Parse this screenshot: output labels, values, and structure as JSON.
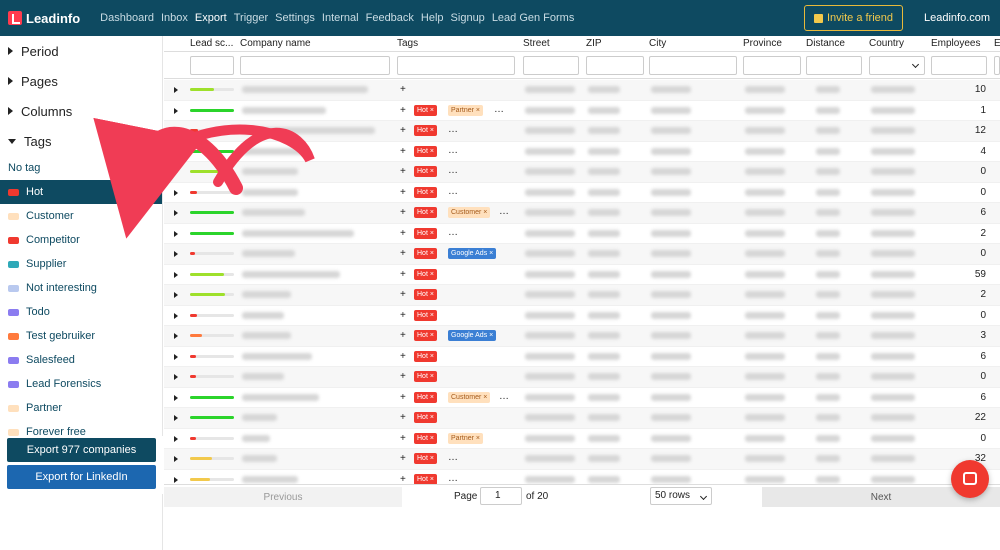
{
  "app": {
    "name": "Leadinfo",
    "domain_link": "Leadinfo.com",
    "invite_label": "Invite a friend"
  },
  "nav": {
    "items": [
      "Dashboard",
      "Inbox",
      "Export",
      "Trigger",
      "Settings",
      "Internal",
      "Feedback",
      "Help",
      "Signup",
      "Lead Gen Forms"
    ],
    "active": "Export"
  },
  "sidebar": {
    "sections": [
      "Period",
      "Pages",
      "Columns",
      "Tags"
    ],
    "no_tag": "No tag",
    "tags": [
      {
        "label": "Hot",
        "color": "#f0392f",
        "selected": true
      },
      {
        "label": "Customer",
        "color": "#ffe0bd"
      },
      {
        "label": "Competitor",
        "color": "#f0392f"
      },
      {
        "label": "Supplier",
        "color": "#2fa9b8"
      },
      {
        "label": "Not interesting",
        "color": "#b9c9ef"
      },
      {
        "label": "Todo",
        "color": "#8b7cf0"
      },
      {
        "label": "Test gebruiker",
        "color": "#ff7a3d"
      },
      {
        "label": "Salesfeed",
        "color": "#8b7cf0"
      },
      {
        "label": "Lead Forensics",
        "color": "#8b7cf0"
      },
      {
        "label": "Partner",
        "color": "#ffe0bd"
      },
      {
        "label": "Forever free",
        "color": "#ffe0bd"
      }
    ],
    "export_companies": "Export 977 companies",
    "export_linkedin": "Export for LinkedIn"
  },
  "table": {
    "headers": [
      "Lead sc...",
      "Company name",
      "Tags",
      "Street",
      "ZIP",
      "City",
      "Province",
      "Distance",
      "Country",
      "Employees",
      "E"
    ],
    "rows": [
      {
        "score": 0.55,
        "score_color": "#9ee02b",
        "tags": [],
        "employees": "10"
      },
      {
        "score": 1.0,
        "score_color": "#2bd42b",
        "tags": [
          "Hot",
          "Partner"
        ],
        "more": true,
        "employees": "1"
      },
      {
        "score": 0.18,
        "score_color": "#f0392f",
        "tags": [
          "Hot"
        ],
        "more": true,
        "employees": "12"
      },
      {
        "score": 1.0,
        "score_color": "#2bd42b",
        "tags": [
          "Hot"
        ],
        "more": true,
        "employees": "4"
      },
      {
        "score": 0.65,
        "score_color": "#9ee02b",
        "tags": [
          "Hot"
        ],
        "more": true,
        "employees": "0"
      },
      {
        "score": 0.15,
        "score_color": "#f0392f",
        "tags": [
          "Hot"
        ],
        "more": true,
        "employees": "0"
      },
      {
        "score": 1.0,
        "score_color": "#2bd42b",
        "tags": [
          "Hot",
          "Customer"
        ],
        "more": true,
        "employees": "6"
      },
      {
        "score": 1.0,
        "score_color": "#2bd42b",
        "tags": [
          "Hot"
        ],
        "more": true,
        "employees": "2"
      },
      {
        "score": 0.12,
        "score_color": "#f0392f",
        "tags": [
          "Hot",
          "Google Ads"
        ],
        "employees": "0"
      },
      {
        "score": 0.78,
        "score_color": "#9ee02b",
        "tags": [
          "Hot"
        ],
        "employees": "59"
      },
      {
        "score": 0.8,
        "score_color": "#9ee02b",
        "tags": [
          "Hot"
        ],
        "employees": "2"
      },
      {
        "score": 0.15,
        "score_color": "#f0392f",
        "tags": [
          "Hot"
        ],
        "employees": "0"
      },
      {
        "score": 0.28,
        "score_color": "#ff7a3d",
        "tags": [
          "Hot",
          "Google Ads"
        ],
        "employees": "3"
      },
      {
        "score": 0.14,
        "score_color": "#f0392f",
        "tags": [
          "Hot"
        ],
        "employees": "6"
      },
      {
        "score": 0.14,
        "score_color": "#f0392f",
        "tags": [
          "Hot"
        ],
        "employees": "0"
      },
      {
        "score": 1.0,
        "score_color": "#2bd42b",
        "tags": [
          "Hot",
          "Customer"
        ],
        "more": true,
        "employees": "6"
      },
      {
        "score": 1.0,
        "score_color": "#2bd42b",
        "tags": [
          "Hot"
        ],
        "employees": "22"
      },
      {
        "score": 0.14,
        "score_color": "#f0392f",
        "tags": [
          "Hot",
          "Partner"
        ],
        "employees": "0"
      },
      {
        "score": 0.5,
        "score_color": "#f2c94c",
        "tags": [
          "Hot"
        ],
        "more": true,
        "employees": "32"
      },
      {
        "score": 0.45,
        "score_color": "#f2c94c",
        "tags": [
          "Hot"
        ],
        "more": true,
        "employees": ""
      }
    ]
  },
  "pager": {
    "previous": "Previous",
    "page_label": "Page",
    "page_value": "1",
    "of_label": "of 20",
    "rows_option": "50 rows",
    "next": "Next"
  },
  "colors": {
    "brand": "#0e4a61",
    "accent": "#f0392f",
    "annotation_arrow": "#f03c55"
  }
}
